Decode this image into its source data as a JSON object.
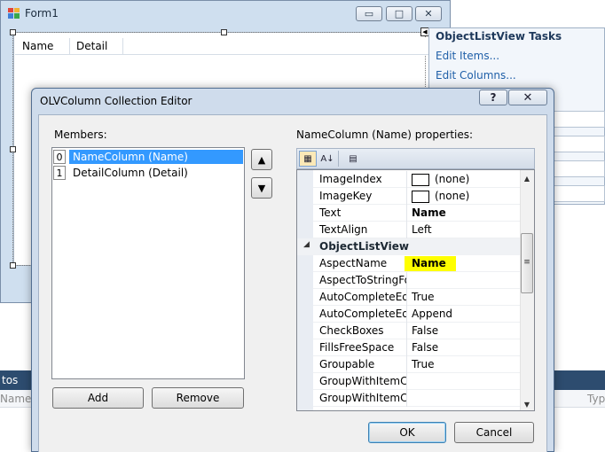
{
  "form1": {
    "title": "Form1",
    "columns": [
      "Name",
      "Detail"
    ],
    "caption_buttons": {
      "minimize": "▭",
      "maximize": "□",
      "close": "✕"
    }
  },
  "tasks_panel": {
    "title": "ObjectListView Tasks",
    "links": [
      "Edit Items...",
      "Edit Columns..."
    ]
  },
  "background_strip": {
    "label": "tos",
    "name_col": "Name",
    "type_col": "Typ"
  },
  "dialog": {
    "title": "OLVColumn Collection Editor",
    "help": "?",
    "close": "✕",
    "members_label": "Members:",
    "members": [
      {
        "index": "0",
        "label": "NameColumn (Name)",
        "selected": true
      },
      {
        "index": "1",
        "label": "DetailColumn (Detail)",
        "selected": false
      }
    ],
    "up_arrow": "▲",
    "down_arrow": "▼",
    "add_label": "Add",
    "remove_label": "Remove",
    "properties_label": "NameColumn (Name) properties:",
    "toolbar": {
      "categorized": "▦",
      "alphabetical": "A↓",
      "pages": "▤"
    },
    "properties": [
      {
        "name": "ImageIndex",
        "value": "(none)",
        "swatch": true
      },
      {
        "name": "ImageKey",
        "value": "(none)",
        "swatch": true
      },
      {
        "name": "Text",
        "value": "Name",
        "bold": true
      },
      {
        "name": "TextAlign",
        "value": "Left"
      }
    ],
    "category": {
      "label": "ObjectListView",
      "arrow": "◢"
    },
    "olv_properties": [
      {
        "name": "AspectName",
        "value": "Name",
        "bold": true,
        "highlight": "#ffff00"
      },
      {
        "name": "AspectToStringFor",
        "value": ""
      },
      {
        "name": "AutoCompleteEdit",
        "value": "True"
      },
      {
        "name": "AutoCompleteEdit",
        "value": "Append"
      },
      {
        "name": "CheckBoxes",
        "value": "False"
      },
      {
        "name": "FillsFreeSpace",
        "value": "False"
      },
      {
        "name": "Groupable",
        "value": "True"
      },
      {
        "name": "GroupWithItemCou",
        "value": ""
      },
      {
        "name": "GroupWithItemCou",
        "value": ""
      }
    ],
    "ok_label": "OK",
    "cancel_label": "Cancel"
  }
}
